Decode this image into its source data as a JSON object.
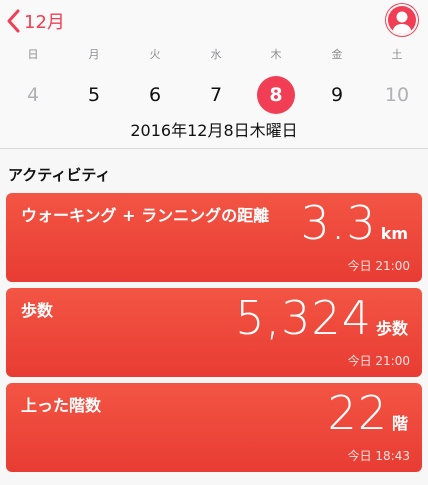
{
  "nav": {
    "back_label": "12月"
  },
  "week": [
    {
      "dow": "日",
      "num": "4",
      "state": "muted"
    },
    {
      "dow": "月",
      "num": "5",
      "state": "normal"
    },
    {
      "dow": "火",
      "num": "6",
      "state": "normal"
    },
    {
      "dow": "水",
      "num": "7",
      "state": "normal"
    },
    {
      "dow": "木",
      "num": "8",
      "state": "selected"
    },
    {
      "dow": "金",
      "num": "9",
      "state": "normal"
    },
    {
      "dow": "土",
      "num": "10",
      "state": "muted"
    }
  ],
  "selected_date": "2016年12月8日木曜日",
  "section_title": "アクティビティ",
  "cards": [
    {
      "title": "ウォーキング + ランニングの距離",
      "value": "3.3",
      "unit": "km",
      "time": "今日 21:00"
    },
    {
      "title": "歩数",
      "value": "5,324",
      "unit": "歩数",
      "time": "今日 21:00"
    },
    {
      "title": "上った階数",
      "value": "22",
      "unit": "階",
      "time": "今日 18:43"
    }
  ],
  "colors": {
    "accent": "#f23e54",
    "card_top": "#f35544",
    "card_bottom": "#e83c33"
  }
}
